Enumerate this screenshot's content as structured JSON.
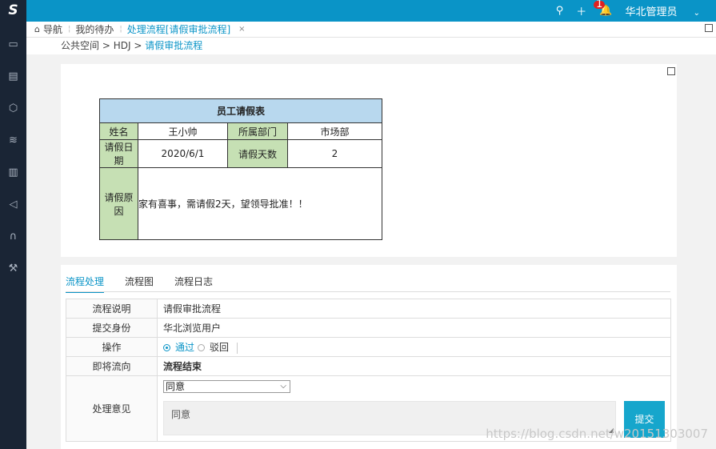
{
  "topbar": {
    "logo": "S",
    "search_icon": "search-icon",
    "add_icon": "plus-icon",
    "bell_badge": "1",
    "user_name": "华北管理员",
    "user_chevron": "chevron-down-icon"
  },
  "sidebar": {
    "items": [
      "monitor-icon",
      "database-icon",
      "cube-icon",
      "layers-icon",
      "bar-chart-icon",
      "send-icon",
      "headset-icon",
      "tools-icon"
    ]
  },
  "tabs": {
    "home_label": "导航",
    "todo_label": "我的待办",
    "active_label": "处理流程[请假审批流程]",
    "close": "×"
  },
  "breadcrumb": {
    "part1": "公共空间",
    "sep1": " >",
    "part2": "HDJ",
    "sep2": " >",
    "current": "请假审批流程"
  },
  "leave_form": {
    "title": "员工请假表",
    "name_label": "姓名",
    "name_value": "王小帅",
    "dept_label": "所属部门",
    "dept_value": "市场部",
    "date_label": "请假日期",
    "date_value": "2020/6/1",
    "days_label": "请假天数",
    "days_value": "2",
    "reason_label": "请假原因",
    "reason_value": "家有喜事，需请假2天，望领导批准！！"
  },
  "flow": {
    "tabs": [
      "流程处理",
      "流程图",
      "流程日志"
    ],
    "desc_label": "流程说明",
    "desc_value": "请假审批流程",
    "identity_label": "提交身份",
    "identity_value": "华北浏览用户",
    "action_label": "操作",
    "action_pass": "通过",
    "action_reject": "驳回",
    "next_label": "即将流向",
    "next_value": "流程结束",
    "opinion_label": "处理意见",
    "opinion_select": "同意",
    "opinion_text": "同意",
    "submit_label": "提交"
  },
  "watermark": "https://blog.csdn.net/w20151303007"
}
